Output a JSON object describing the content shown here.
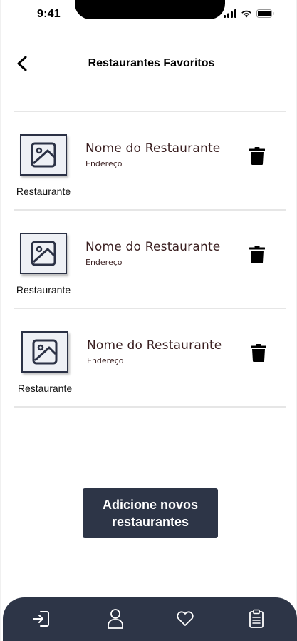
{
  "status_bar": {
    "time": "9:41"
  },
  "header": {
    "title": "Restaurantes Favoritos"
  },
  "restaurants": [
    {
      "name": "Nome do Restaurante",
      "address": "Endereço",
      "image_label": "Restaurante"
    },
    {
      "name": "Nome do Restaurante",
      "address": "Endereço",
      "image_label": "Restaurante"
    },
    {
      "name": "Nome do Restaurante",
      "address": "Endereço",
      "image_label": "Restaurante"
    }
  ],
  "cta": {
    "line1": "Adicione novos",
    "line2": "restaurantes"
  },
  "bottom_nav": {
    "items": [
      {
        "icon": "login-icon"
      },
      {
        "icon": "user-icon"
      },
      {
        "icon": "heart-icon"
      },
      {
        "icon": "clipboard-icon"
      }
    ]
  },
  "colors": {
    "primary_dark": "#2d3547",
    "name_text": "#3a1f20",
    "thumb_bg": "#eef0f5"
  }
}
